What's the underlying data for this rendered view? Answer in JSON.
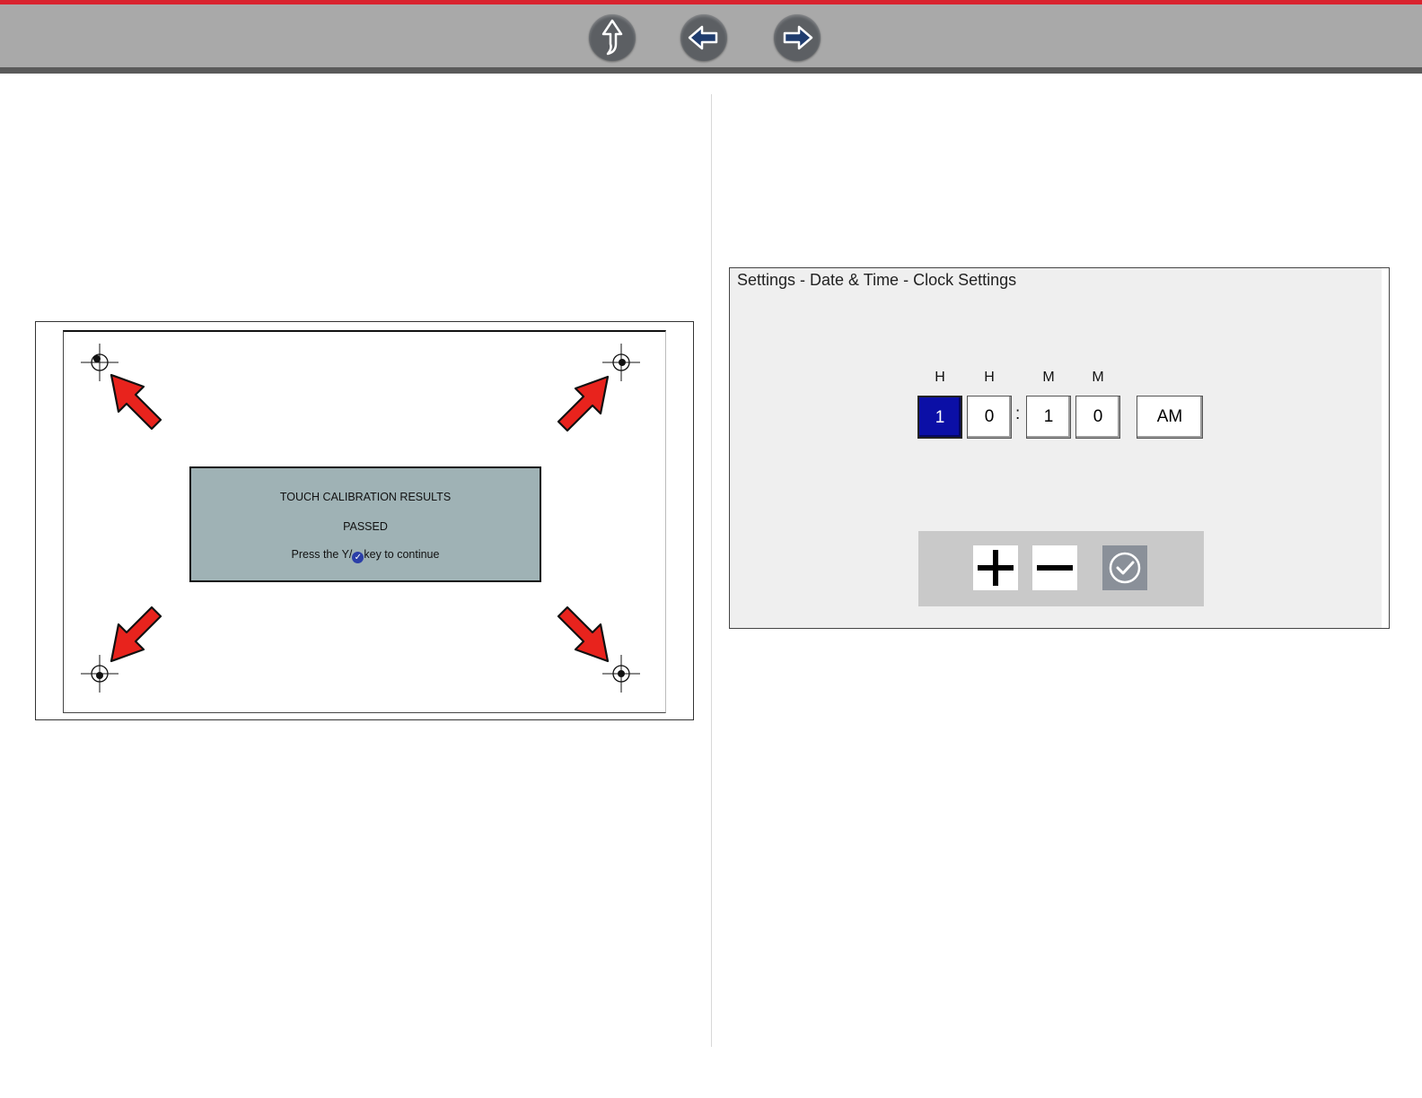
{
  "nav": {
    "buttons": [
      {
        "name": "up-button",
        "icon": "up-arrow-icon"
      },
      {
        "name": "back-button",
        "icon": "left-arrow-icon"
      },
      {
        "name": "forward-button",
        "icon": "right-arrow-icon"
      }
    ],
    "accent_color": "#d9232e"
  },
  "calibration": {
    "title": "TOUCH CALIBRATION RESULTS",
    "status": "PASSED",
    "message_prefix": "Press the Y/",
    "message_suffix": "key to continue",
    "check_icon": "checkmark-icon",
    "arrow_color": "#e8231d"
  },
  "clock": {
    "title": "Settings - Date & Time - Clock Settings",
    "labels": [
      "H",
      "H",
      "M",
      "M"
    ],
    "digits": [
      "1",
      "0",
      "1",
      "0"
    ],
    "separator": ":",
    "selected_index": 0,
    "meridiem": "AM",
    "controls": [
      {
        "name": "increment-button",
        "icon": "plus-icon"
      },
      {
        "name": "decrement-button",
        "icon": "minus-icon"
      },
      {
        "name": "confirm-button",
        "icon": "checkmark-icon"
      }
    ],
    "selected_color": "#0b0fa6"
  }
}
